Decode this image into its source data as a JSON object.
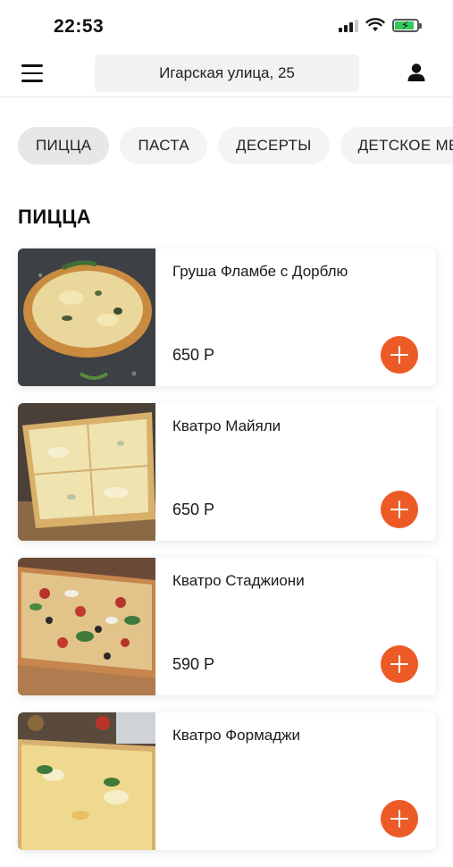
{
  "status_bar": {
    "time": "22:53"
  },
  "header": {
    "address": "Игарская улица, 25",
    "menu_icon": "hamburger-menu-icon",
    "profile_icon": "user-icon"
  },
  "categories": [
    {
      "label": "ПИЦЦА",
      "active": true
    },
    {
      "label": "ПАСТА",
      "active": false
    },
    {
      "label": "ДЕСЕРТЫ",
      "active": false
    },
    {
      "label": "ДЕТСКОЕ МЕНЮ",
      "active": false
    }
  ],
  "section": {
    "title": "ПИЦЦА"
  },
  "products": [
    {
      "name": "Груша Фламбе с Дорблю",
      "price": "650 Р"
    },
    {
      "name": "Кватро Майяли",
      "price": "650 Р"
    },
    {
      "name": "Кватро Стаджиони",
      "price": "590 Р"
    },
    {
      "name": "Кватро Формаджи",
      "price": ""
    }
  ],
  "colors": {
    "accent": "#ec5a25",
    "chip_bg": "#f4f4f4"
  }
}
